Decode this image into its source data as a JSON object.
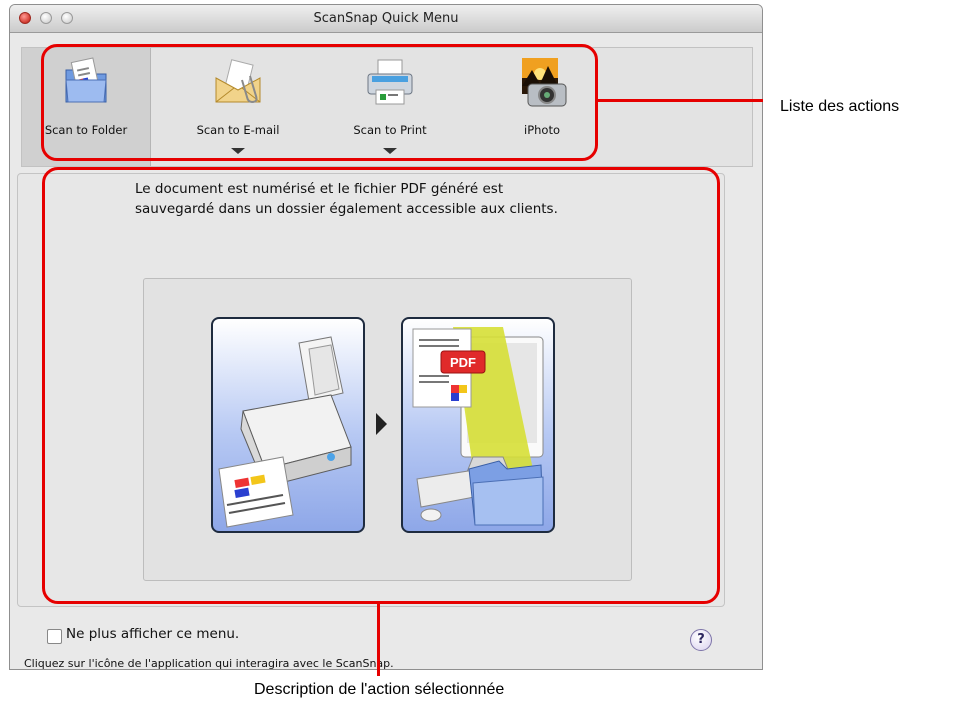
{
  "window": {
    "title": "ScanSnap Quick Menu"
  },
  "actions": [
    {
      "label": "Scan to Folder",
      "has_menu": false,
      "selected": true
    },
    {
      "label": "Scan to E-mail",
      "has_menu": true,
      "selected": false
    },
    {
      "label": "Scan to Print",
      "has_menu": true,
      "selected": false
    },
    {
      "label": "iPhoto",
      "has_menu": false,
      "selected": false
    }
  ],
  "description": {
    "line1": "Le document est numérisé et le fichier PDF généré est",
    "line2": "sauvegardé dans un dossier également accessible aux clients.",
    "pdf_badge": "PDF"
  },
  "footer": {
    "checkbox_label": "Ne plus afficher ce menu.",
    "checkbox_checked": false,
    "hint": "Cliquez sur l'icône de l'application qui interagira avec le ScanSnap.",
    "help_symbol": "?"
  },
  "annotations": {
    "actions_list": "Liste des actions",
    "description": "Description de l'action sélectionnée"
  },
  "colors": {
    "callout": "#e60000"
  }
}
